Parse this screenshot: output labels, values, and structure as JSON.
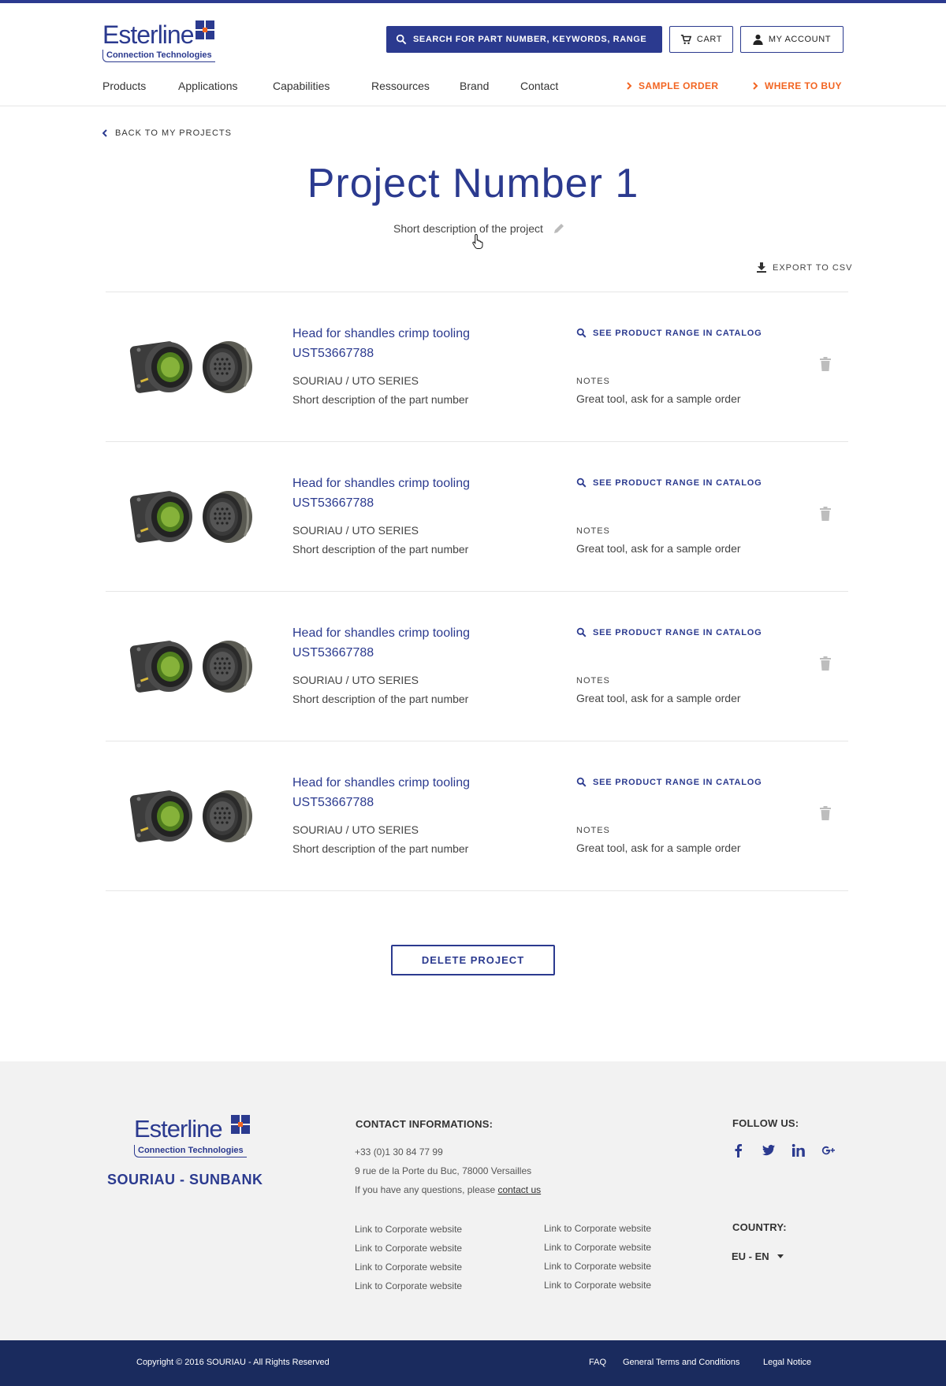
{
  "header": {
    "logo_word": "Esterline",
    "logo_sub": "Connection Technologies",
    "search_label": "SEARCH FOR PART NUMBER, KEYWORDS, RANGE",
    "cart_label": "CART",
    "account_label": "MY ACCOUNT"
  },
  "nav": {
    "items": [
      "Products",
      "Applications",
      "Capabilities",
      "Ressources",
      "Brand",
      "Contact"
    ],
    "sample_order": "SAMPLE ORDER",
    "where_to_buy": "WHERE TO BUY"
  },
  "page": {
    "back_label": "BACK TO MY PROJECTS",
    "title": "Project Number 1",
    "description": "Short description of the project",
    "export_label": "EXPORT TO CSV",
    "delete_label": "DELETE PROJECT"
  },
  "products": [
    {
      "name": "Head for shandles crimp tooling UST53667788",
      "series": "SOURIAU / UTO SERIES",
      "description": "Short description of the part number",
      "catalog_link": "SEE PRODUCT RANGE IN CATALOG",
      "notes_label": "NOTES",
      "notes": "Great tool, ask for a sample order"
    },
    {
      "name": "Head for shandles crimp tooling UST53667788",
      "series": "SOURIAU / UTO SERIES",
      "description": "Short description of the part number",
      "catalog_link": "SEE PRODUCT RANGE IN CATALOG",
      "notes_label": "NOTES",
      "notes": "Great tool, ask for a sample order"
    },
    {
      "name": "Head for shandles crimp tooling UST53667788",
      "series": "SOURIAU / UTO SERIES",
      "description": "Short description of the part number",
      "catalog_link": "SEE PRODUCT RANGE IN CATALOG",
      "notes_label": "NOTES",
      "notes": "Great tool, ask for a sample order"
    },
    {
      "name": "Head for shandles crimp tooling UST53667788",
      "series": "SOURIAU / UTO SERIES",
      "description": "Short description of the part number",
      "catalog_link": "SEE PRODUCT RANGE IN CATALOG",
      "notes_label": "NOTES",
      "notes": "Great tool, ask for a sample order"
    }
  ],
  "footer": {
    "brand": "SOURIAU - SUNBANK",
    "contact_heading": "CONTACT INFORMATIONS:",
    "phone": "+33 (0)1 30 84 77 99",
    "address": "9 rue de la Porte du Buc, 78000 Versailles",
    "question_text": "If you have any questions, please ",
    "contact_link": "contact us",
    "links_col1": [
      "Link to Corporate website",
      "Link to Corporate website",
      "Link to Corporate website",
      "Link to Corporate website"
    ],
    "links_col2": [
      "Link to Corporate website",
      "Link to Corporate website",
      "Link to Corporate website",
      "Link to Corporate website"
    ],
    "follow_heading": "FOLLOW US:",
    "country_heading": "COUNTRY:",
    "country_value": "EU - EN"
  },
  "bottom": {
    "copyright": "Copyright © 2016 SOURIAU - All Rights Reserved",
    "faq": "FAQ",
    "terms": "General Terms and Conditions",
    "legal": "Legal Notice"
  },
  "colors": {
    "brand_blue": "#2b3a8f",
    "accent_orange": "#f26522",
    "footer_dark": "#1a2b5e"
  }
}
